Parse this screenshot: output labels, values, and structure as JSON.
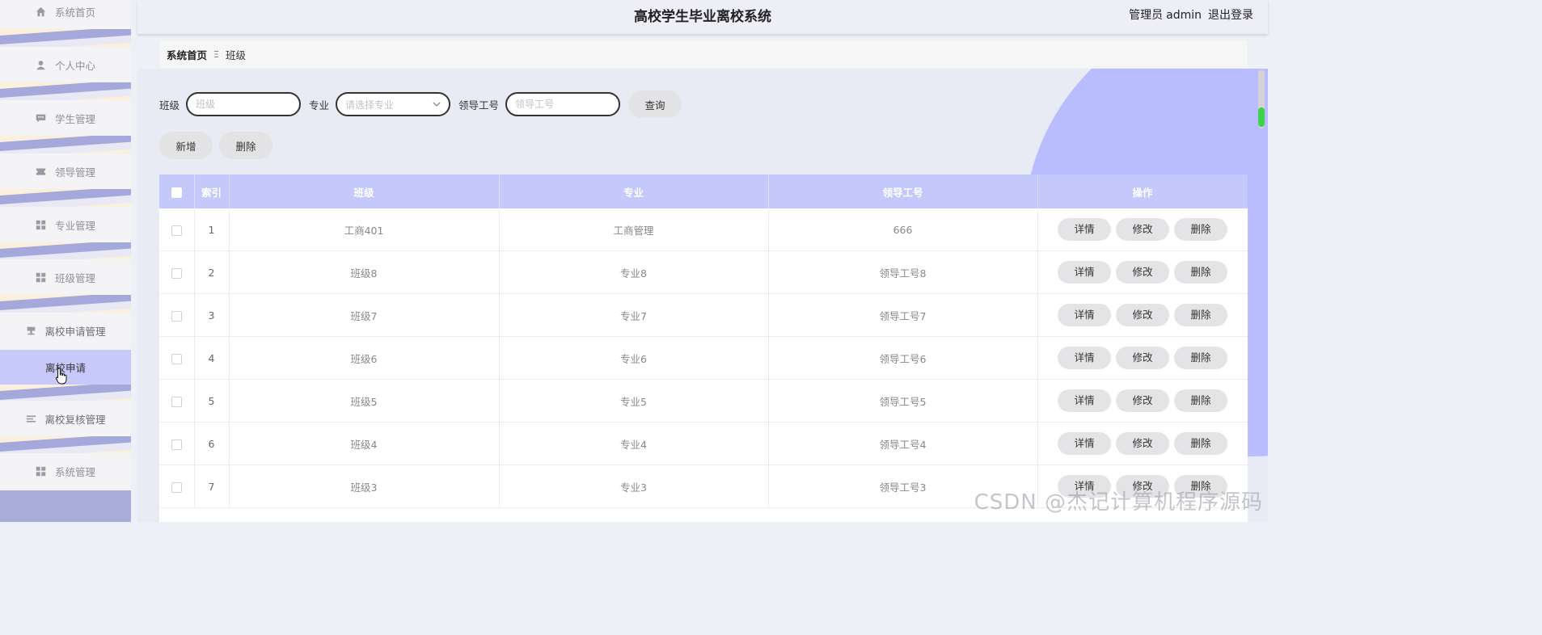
{
  "app_title": "高校学生毕业离校系统",
  "header": {
    "role": "管理员",
    "username": "admin",
    "logout": "退出登录"
  },
  "sidebar": {
    "items": [
      {
        "label": "系统首页",
        "icon": "home-icon"
      },
      {
        "label": "个人中心",
        "icon": "user-icon"
      },
      {
        "label": "学生管理",
        "icon": "chat-icon"
      },
      {
        "label": "领导管理",
        "icon": "ticket-icon"
      },
      {
        "label": "专业管理",
        "icon": "grid-icon"
      },
      {
        "label": "班级管理",
        "icon": "grid-icon"
      },
      {
        "label": "离校申请管理",
        "icon": "stamp-icon"
      },
      {
        "label": "离校复核管理",
        "icon": "list-icon"
      },
      {
        "label": "系统管理",
        "icon": "grid-icon"
      }
    ],
    "sub_item": "离校申请"
  },
  "breadcrumb": {
    "home": "系统首页",
    "current": "班级"
  },
  "search": {
    "class_label": "班级",
    "class_placeholder": "班级",
    "major_label": "专业",
    "major_placeholder": "请选择专业",
    "leader_label": "领导工号",
    "leader_placeholder": "领导工号",
    "query_button": "查询"
  },
  "actions": {
    "add": "新增",
    "delete": "删除"
  },
  "table": {
    "headers": [
      "索引",
      "班级",
      "专业",
      "领导工号",
      "操作"
    ],
    "op_labels": {
      "detail": "详情",
      "edit": "修改",
      "delete": "删除"
    },
    "rows": [
      {
        "index": "1",
        "class": "工商401",
        "major": "工商管理",
        "leader": "666"
      },
      {
        "index": "2",
        "class": "班级8",
        "major": "专业8",
        "leader": "领导工号8"
      },
      {
        "index": "3",
        "class": "班级7",
        "major": "专业7",
        "leader": "领导工号7"
      },
      {
        "index": "4",
        "class": "班级6",
        "major": "专业6",
        "leader": "领导工号6"
      },
      {
        "index": "5",
        "class": "班级5",
        "major": "专业5",
        "leader": "领导工号5"
      },
      {
        "index": "6",
        "class": "班级4",
        "major": "专业4",
        "leader": "领导工号4"
      },
      {
        "index": "7",
        "class": "班级3",
        "major": "专业3",
        "leader": "领导工号3"
      }
    ]
  },
  "watermark": "CSDN @杰记计算机程序源码",
  "colors": {
    "accent": "#c5c8fb",
    "sidebar_band": "#a5a8da",
    "deco": "#b9bcff"
  }
}
